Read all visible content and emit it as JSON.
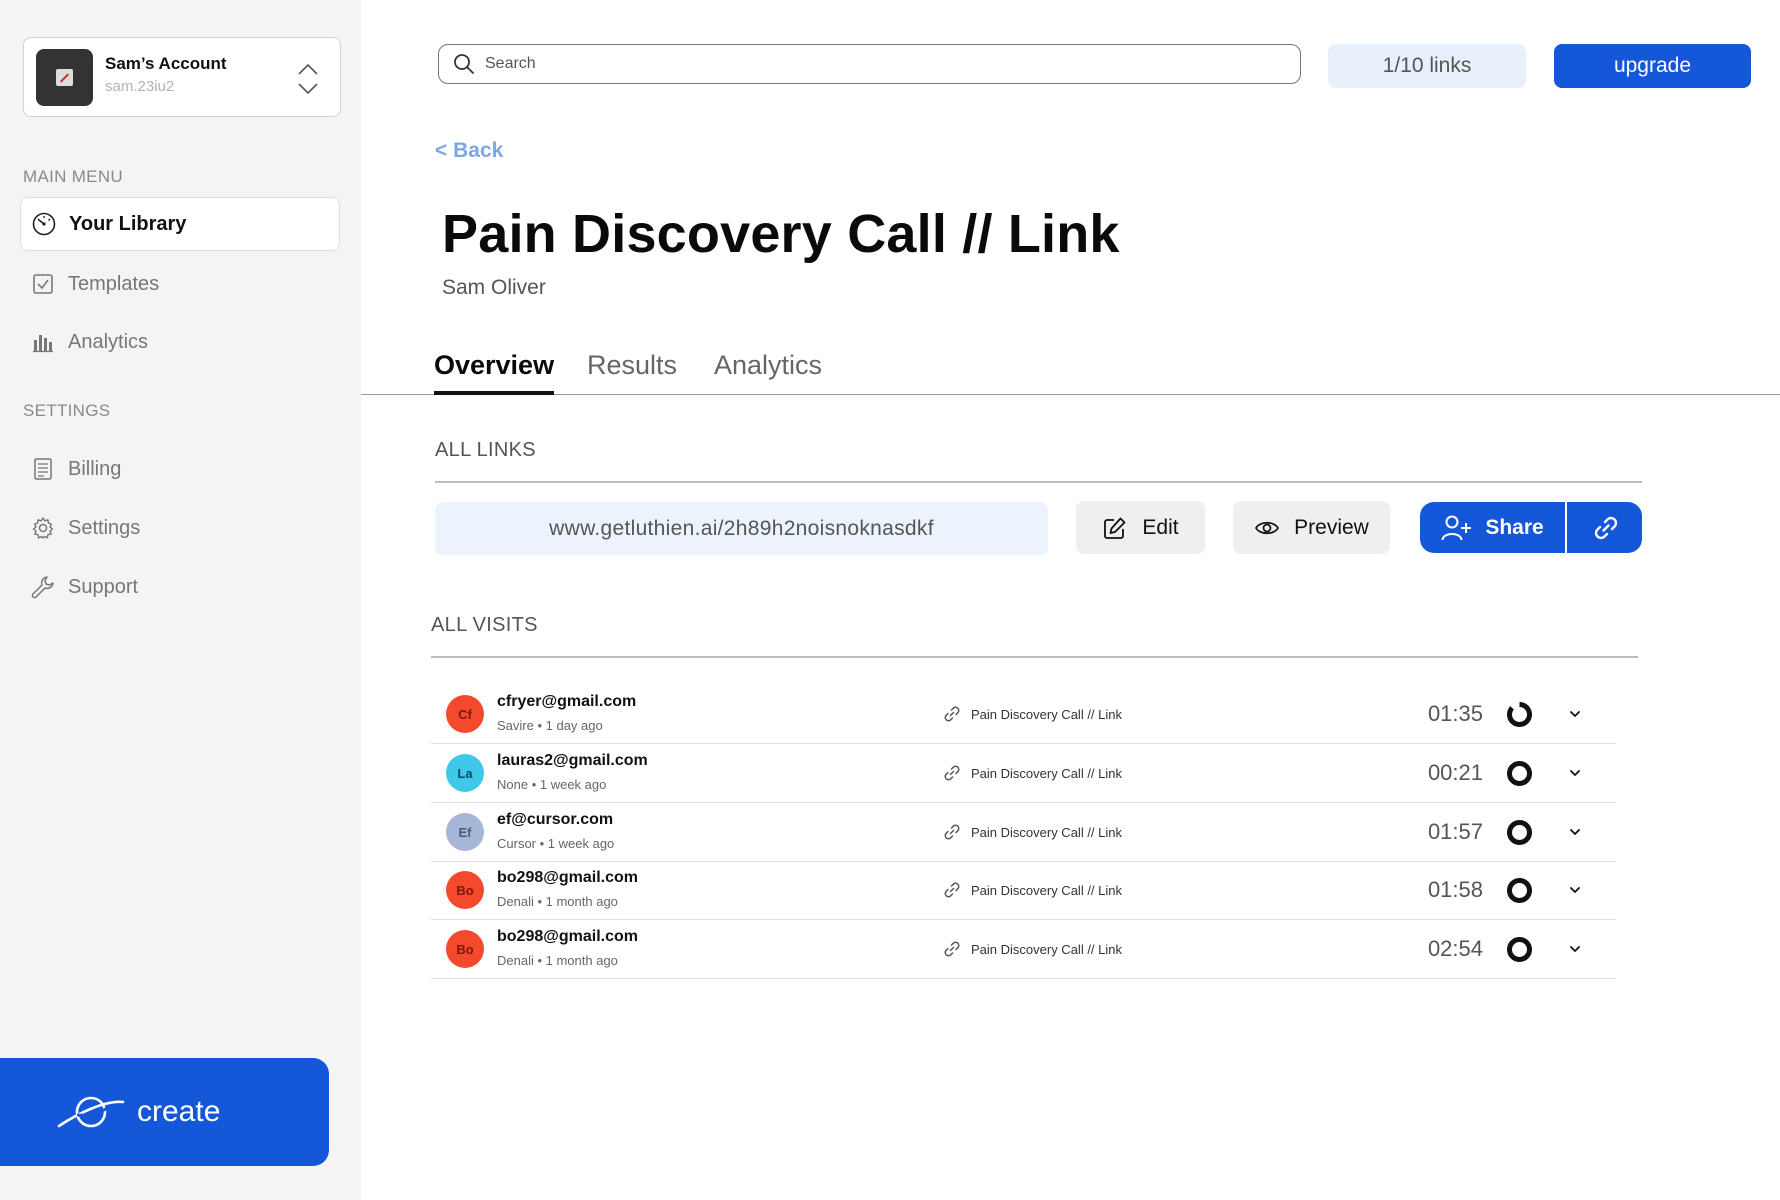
{
  "account": {
    "name": "Sam’s Account",
    "handle": "sam.23iu2"
  },
  "sidebar": {
    "main_menu_label": "MAIN MENU",
    "settings_label": "SETTINGS",
    "items": [
      {
        "label": "Your Library",
        "icon": "gauge-icon"
      },
      {
        "label": "Templates",
        "icon": "checkbox-icon"
      },
      {
        "label": "Analytics",
        "icon": "bar-chart-icon"
      },
      {
        "label": "Billing",
        "icon": "receipt-icon"
      },
      {
        "label": "Settings",
        "icon": "gear-icon"
      },
      {
        "label": "Support",
        "icon": "wrench-icon"
      }
    ],
    "create_label": "create"
  },
  "topbar": {
    "search_placeholder": "Search",
    "links_count": "1/10 links",
    "upgrade_label": "upgrade"
  },
  "page": {
    "back_label": "< Back",
    "title": "Pain Discovery Call // Link",
    "subtitle": "Sam Oliver",
    "tabs": [
      "Overview",
      "Results",
      "Analytics"
    ],
    "all_links_label": "ALL LINKS",
    "link_url": "www.getluthien.ai/2h89h2noisnoknasdkf",
    "edit_label": "Edit",
    "preview_label": "Preview",
    "share_label": "Share",
    "all_visits_label": "ALL VISITS"
  },
  "colors": {
    "accent": "#1557d9",
    "light_accent": "#e8f0fb"
  },
  "visits": [
    {
      "initials": "Cf",
      "avatar_color": "#f4492c",
      "initials_color": "#7a1a0a",
      "email": "cfryer@gmail.com",
      "meta": "Savire  • 1 day ago",
      "link": "Pain Discovery Call // Link",
      "duration": "01:35"
    },
    {
      "initials": "La",
      "avatar_color": "#3ec8ea",
      "initials_color": "#0a4a66",
      "email": "lauras2@gmail.com",
      "meta": "None  •   1 week ago",
      "link": "Pain Discovery Call // Link",
      "duration": "00:21"
    },
    {
      "initials": "Ef",
      "avatar_color": "#a6b6d6",
      "initials_color": "#4a5a7a",
      "email": "ef@cursor.com",
      "meta": "Cursor • 1 week ago",
      "link": "Pain Discovery Call // Link",
      "duration": "01:57"
    },
    {
      "initials": "Bo",
      "avatar_color": "#f4492c",
      "initials_color": "#7a1a0a",
      "email": "bo298@gmail.com",
      "meta": "Denali • 1 month ago",
      "link": "Pain Discovery Call // Link",
      "duration": "01:58"
    },
    {
      "initials": "Bo",
      "avatar_color": "#f4492c",
      "initials_color": "#7a1a0a",
      "email": "bo298@gmail.com",
      "meta": "Denali • 1 month ago",
      "link": "Pain Discovery Call // Link",
      "duration": "02:54"
    }
  ]
}
